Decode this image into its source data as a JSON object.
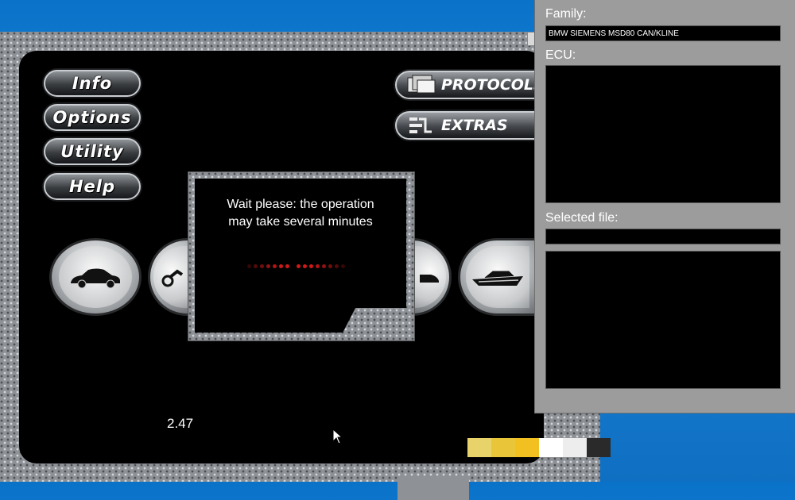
{
  "menu": {
    "info": "Info",
    "options": "Options",
    "utility": "Utility",
    "help": "Help"
  },
  "actions": {
    "protocols": "PROTOCOLS",
    "extras": "EXTRAS"
  },
  "vehicles": [
    "car-icon",
    "motorbike-icon",
    "car-icon",
    "boat-icon"
  ],
  "version": "2.47",
  "dialog": {
    "line1": "Wait please: the operation",
    "line2": "may take several minutes"
  },
  "panel": {
    "family_label": "Family:",
    "family_value": "BMW SIEMENS MSD80 CAN/KLINE",
    "ecu_label": "ECU:",
    "ecu_value": "",
    "selected_file_label": "Selected file:",
    "selected_file_value": ""
  },
  "colors": {
    "desktop": "#1e86d8",
    "panel": "#9c9c9c",
    "progress_dots": "#d01818"
  }
}
